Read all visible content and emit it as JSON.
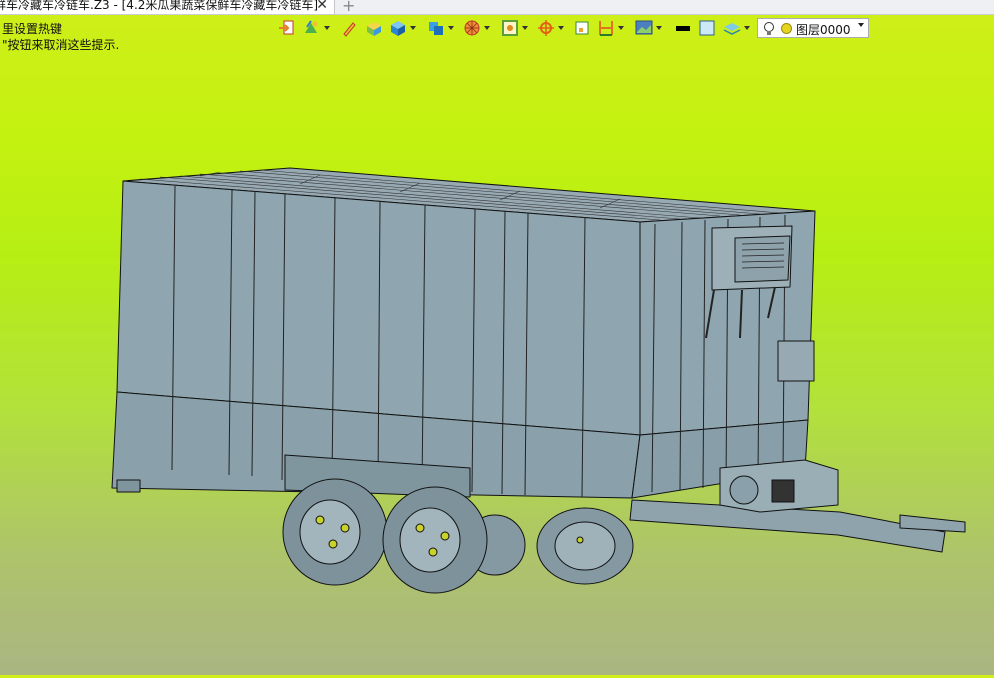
{
  "window": {
    "tab_title": "鲜车冷藏车冷链车.Z3 - [4.2米瓜果蔬菜保鲜车冷藏车冷链车]",
    "close_glyph": "✕",
    "new_tab_glyph": "+"
  },
  "hints": {
    "line1": "里设置热键",
    "line2": "\"按钮来取消这些提示."
  },
  "toolbar": {
    "layer_value": "图层0000",
    "icons": [
      "import-icon",
      "material-icon",
      "pencil-icon",
      "box-solid-icon",
      "cube-icon",
      "shaded-cube-icon",
      "render-sphere-icon",
      "frame-icon",
      "pivot-icon",
      "grid-square-icon",
      "dimension-icon",
      "image-view-icon",
      "line-color-swatch",
      "fill-swatch",
      "layer-stack-icon",
      "bulb-icon",
      "layer-color-dot"
    ],
    "accent_colors": {
      "line_swatch": "#000000",
      "fill_swatch": "#cde9f7",
      "layer_dot": "#e6d421"
    }
  },
  "viewport": {
    "background_top": "#c8f010",
    "background_bottom": "#aab582",
    "model_fill": "#8fa6b0",
    "edge_color": "#111111",
    "wheel_hub": "#c8d22a"
  }
}
